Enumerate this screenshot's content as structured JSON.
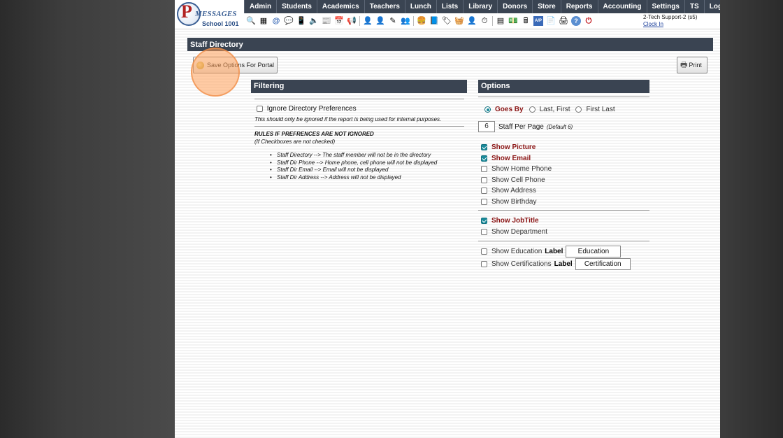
{
  "app": {
    "logo_letter": "P",
    "logo_text": "MESSAGES",
    "school": "School 1001"
  },
  "nav": [
    "Admin",
    "Students",
    "Academics",
    "Teachers",
    "Lunch",
    "Lists",
    "Library",
    "Donors",
    "Store",
    "Reports",
    "Accounting",
    "Settings",
    "TS",
    "Logout"
  ],
  "toolbar_icons": [
    {
      "name": "search-icon",
      "glyph": "🔍"
    },
    {
      "name": "calendar-grid-icon",
      "glyph": "▦"
    },
    {
      "name": "at-email-icon",
      "glyph": "@"
    },
    {
      "name": "chat-icon",
      "glyph": "💬"
    },
    {
      "name": "phone-icon",
      "glyph": "📱"
    },
    {
      "name": "speaker-icon",
      "glyph": "🔈"
    },
    {
      "name": "news-icon",
      "glyph": "📰"
    },
    {
      "name": "calendar-icon",
      "glyph": "📅"
    },
    {
      "name": "megaphone-icon",
      "glyph": "📢"
    },
    {
      "name": "sep"
    },
    {
      "name": "person-icon",
      "glyph": "👤"
    },
    {
      "name": "teacher-icon",
      "glyph": "👤"
    },
    {
      "name": "pencil-icon",
      "glyph": "✎"
    },
    {
      "name": "people-icon",
      "glyph": "👥"
    },
    {
      "name": "sep"
    },
    {
      "name": "burger-icon",
      "glyph": "🍔"
    },
    {
      "name": "book-icon",
      "glyph": "📘"
    },
    {
      "name": "tag-icon",
      "glyph": "🏷"
    },
    {
      "name": "basket-icon",
      "glyph": "🧺"
    },
    {
      "name": "user-admin-icon",
      "glyph": "👤"
    },
    {
      "name": "clock-icon",
      "glyph": "⏱"
    },
    {
      "name": "sep"
    },
    {
      "name": "grid-icon",
      "glyph": "▤"
    },
    {
      "name": "money-icon",
      "glyph": "💵"
    },
    {
      "name": "register-icon",
      "glyph": "🖩"
    },
    {
      "name": "ap-icon",
      "glyph": "A/P"
    },
    {
      "name": "pdf-icon",
      "glyph": "📄"
    },
    {
      "name": "printer-stack-icon",
      "glyph": "🖨"
    },
    {
      "name": "help-icon",
      "glyph": "?"
    },
    {
      "name": "power-icon",
      "glyph": "⏻"
    }
  ],
  "user": {
    "name": "2-Tech Support-2 (s5)",
    "clock_in": "Clock In"
  },
  "page_title": "Staff Directory",
  "save_button": "Save Options For Portal",
  "print_button": "Print",
  "filtering": {
    "heading": "Filtering",
    "ignore_label": "Ignore Directory Preferences",
    "ignore_checked": false,
    "ignore_note": "This should only be ignored if the report is being used for internal purposes.",
    "rules_title": "RULES IF PREFRENCES ARE NOT IGNORED",
    "rules_sub": "(If Checkboxes are not checked)",
    "rules": [
      "Staff Directory --> The staff member will not be in the directory",
      "Staff Dir Phone --> Home phone, cell phone will not be displayed",
      "Staff Dir Email --> Email will not be displayed",
      "Staff Dir Address --> Address will not be displayed"
    ]
  },
  "options": {
    "heading": "Options",
    "name_format": {
      "selected": "Goes By",
      "choices": [
        "Goes By",
        "Last, First",
        "First Last"
      ]
    },
    "per_page": {
      "value": "6",
      "label": "Staff Per Page",
      "default_note": "(Default 6)"
    },
    "show_items": [
      {
        "label": "Show Picture",
        "checked": true
      },
      {
        "label": "Show Email",
        "checked": true
      },
      {
        "label": "Show Home Phone",
        "checked": false
      },
      {
        "label": "Show Cell Phone",
        "checked": false
      },
      {
        "label": "Show Address",
        "checked": false
      },
      {
        "label": "Show Birthday",
        "checked": false
      }
    ],
    "job_items": [
      {
        "label": "Show JobTitle",
        "checked": true
      },
      {
        "label": "Show Department",
        "checked": false
      }
    ],
    "education": {
      "label": "Show Education",
      "label_word": "Label",
      "value": "Education",
      "checked": false
    },
    "certifications": {
      "label": "Show Certifications",
      "label_word": "Label",
      "value": "Certification",
      "checked": false
    }
  },
  "colors": {
    "header_bar": "#3a4452",
    "accent_red": "#8b1515",
    "check_teal": "#1a8a9a",
    "click_highlight": "#ffa05a"
  }
}
